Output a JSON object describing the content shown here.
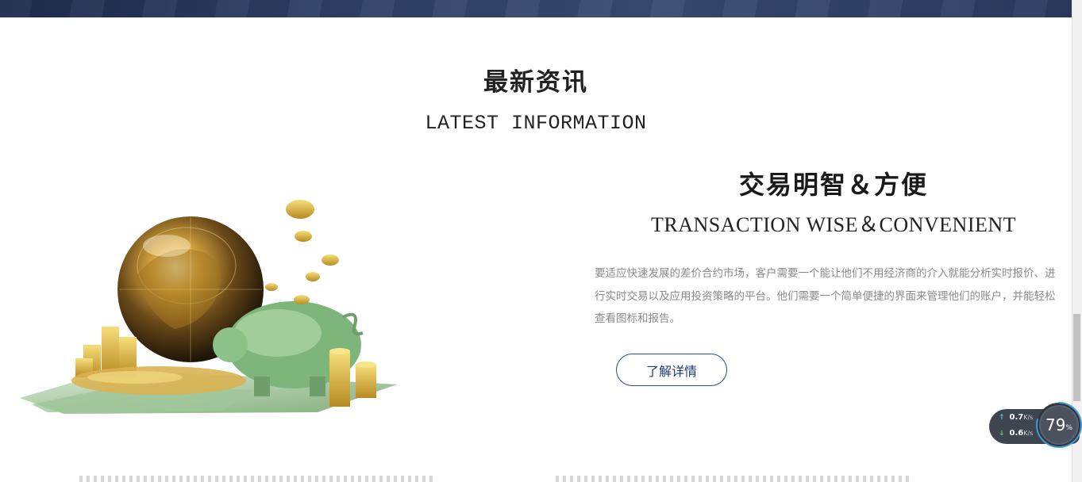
{
  "section": {
    "title": "最新资讯",
    "subtitle": "LATEST INFORMATION"
  },
  "feature": {
    "title": "交易明智＆方便",
    "subtitle": "TRANSACTION WISE＆CONVENIENT",
    "description": "要适应快速发展的差价合约市场，客户需要一个能让他们不用经济商的介入就能分析实时报价、进行实时交易以及应用投资策略的平台。他们需要一个简单便捷的界面来管理他们的账户，并能轻松查看图标和报告。",
    "button_label": "了解详情"
  },
  "illustration": {
    "icon": "globe-coins-piggybank-icon"
  },
  "net_monitor": {
    "upload_value": "0.7",
    "upload_unit": "K/s",
    "download_value": "0.6",
    "download_unit": "K/s",
    "memory_percent": "79",
    "percent_sign": "%",
    "memory_level": 0.79
  },
  "colors": {
    "banner": "#2f3f63",
    "button_border": "#2a4a8a",
    "description_text": "#8a8a8a",
    "upload_arrow": "#4cc0e6",
    "download_arrow": "#63c96b"
  }
}
